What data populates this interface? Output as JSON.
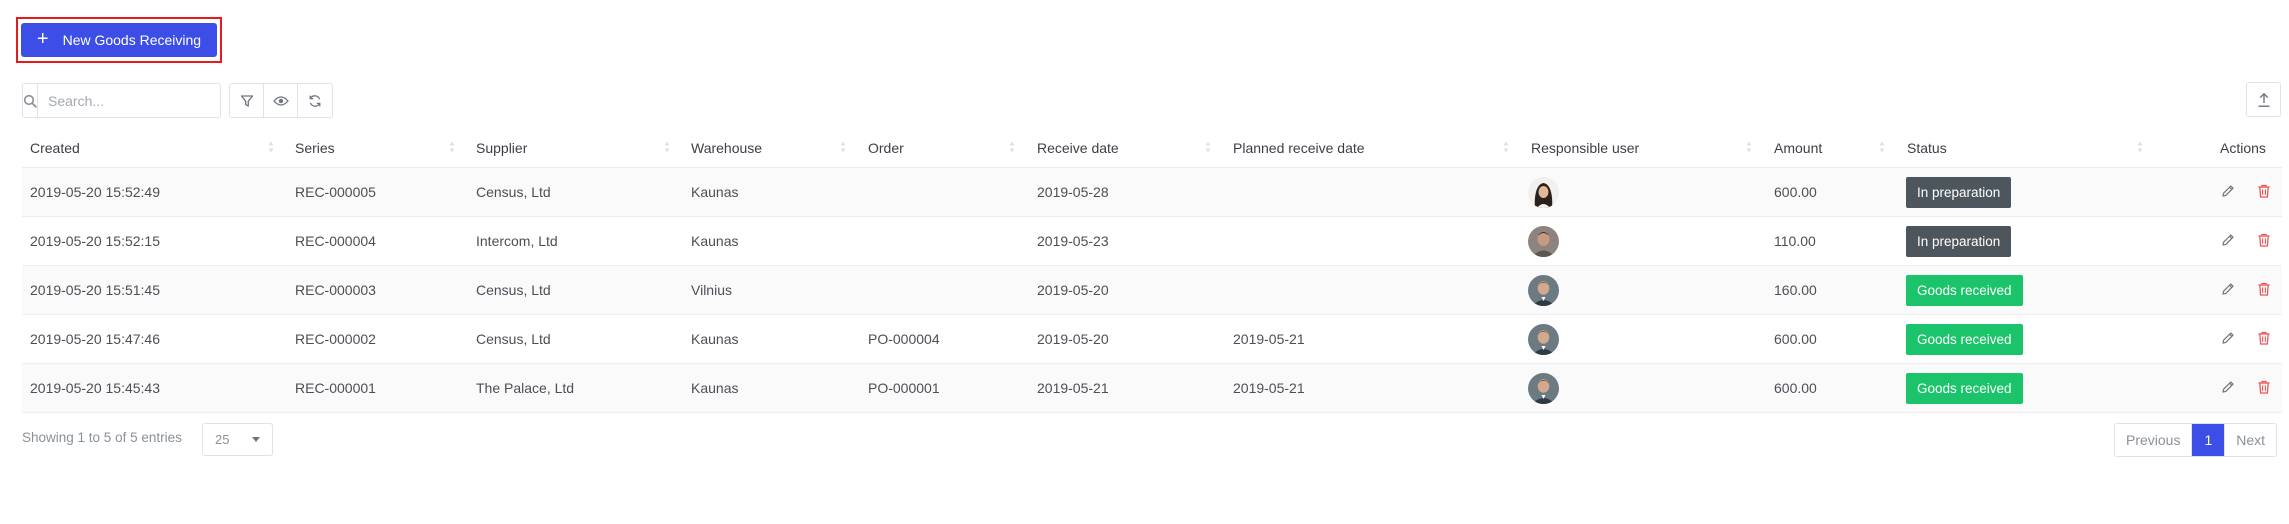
{
  "toolbar": {
    "new_button_label": "New Goods Receiving",
    "new_button_icon": "plus-icon",
    "search_placeholder": "Search...",
    "search_value": "",
    "tools": [
      "filter-icon",
      "eye-icon",
      "refresh-icon"
    ],
    "export_icon": "upload-icon"
  },
  "table": {
    "columns": [
      "Created",
      "Series",
      "Supplier",
      "Warehouse",
      "Order",
      "Receive date",
      "Planned receive date",
      "Responsible user",
      "Amount",
      "Status",
      "Actions"
    ],
    "rows": [
      {
        "created": "2019-05-20 15:52:49",
        "series": "REC-000005",
        "supplier": "Census, Ltd",
        "warehouse": "Kaunas",
        "order": "",
        "receive_date": "2019-05-28",
        "planned_date": "",
        "user_avatar": "female",
        "amount": "600.00",
        "status": "In preparation",
        "status_type": "preparation"
      },
      {
        "created": "2019-05-20 15:52:15",
        "series": "REC-000004",
        "supplier": "Intercom, Ltd",
        "warehouse": "Kaunas",
        "order": "",
        "receive_date": "2019-05-23",
        "planned_date": "",
        "user_avatar": "male-1",
        "amount": "110.00",
        "status": "In preparation",
        "status_type": "preparation"
      },
      {
        "created": "2019-05-20 15:51:45",
        "series": "REC-000003",
        "supplier": "Census, Ltd",
        "warehouse": "Vilnius",
        "order": "",
        "receive_date": "2019-05-20",
        "planned_date": "",
        "user_avatar": "male-2",
        "amount": "160.00",
        "status": "Goods received",
        "status_type": "received"
      },
      {
        "created": "2019-05-20 15:47:46",
        "series": "REC-000002",
        "supplier": "Census, Ltd",
        "warehouse": "Kaunas",
        "order": "PO-000004",
        "receive_date": "2019-05-20",
        "planned_date": "2019-05-21",
        "user_avatar": "male-2",
        "amount": "600.00",
        "status": "Goods received",
        "status_type": "received"
      },
      {
        "created": "2019-05-20 15:45:43",
        "series": "REC-000001",
        "supplier": "The Palace, Ltd",
        "warehouse": "Kaunas",
        "order": "PO-000001",
        "receive_date": "2019-05-21",
        "planned_date": "2019-05-21",
        "user_avatar": "male-2",
        "amount": "600.00",
        "status": "Goods received",
        "status_type": "received"
      }
    ],
    "action_icons": [
      "pencil-icon",
      "trash-icon"
    ]
  },
  "footer": {
    "showing_text": "Showing 1 to 5 of 5 entries",
    "page_size": "25",
    "prev_label": "Previous",
    "current_page": "1",
    "next_label": "Next"
  },
  "colors": {
    "primary": "#3d4ee6",
    "highlight_frame": "#e41c1c",
    "status_preparation": "#4d565d",
    "status_received": "#1bc46a",
    "delete": "#f05454"
  }
}
